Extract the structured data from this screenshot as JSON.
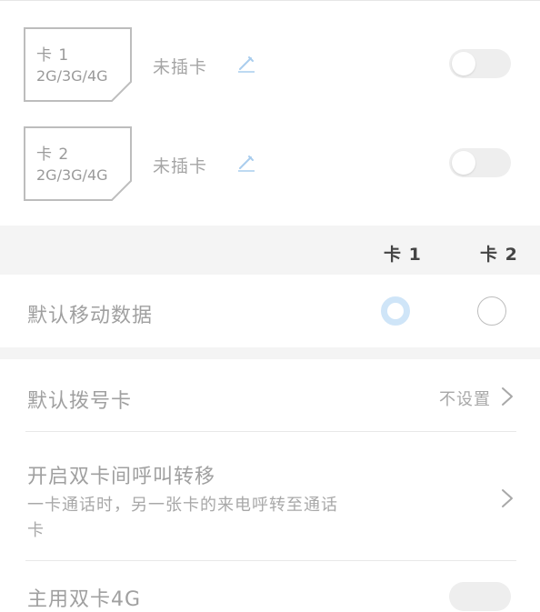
{
  "sims": [
    {
      "name": "卡 1",
      "network": "2G/3G/4G",
      "status": "未插卡",
      "edit_icon": "pencil-icon",
      "enabled": false
    },
    {
      "name": "卡 2",
      "network": "2G/3G/4G",
      "status": "未插卡",
      "edit_icon": "pencil-icon",
      "enabled": false
    }
  ],
  "card_header": {
    "card1": "卡 1",
    "card2": "卡 2"
  },
  "default_data": {
    "label": "默认移动数据",
    "selected": "卡 1"
  },
  "default_dial": {
    "label": "默认拨号卡",
    "value": "不设置"
  },
  "call_forward": {
    "label": "开启双卡间呼叫转移",
    "description": "一卡通话时，另一张卡的来电呼转至通话卡"
  },
  "partial_row": {
    "label": "主用双卡4G"
  },
  "colors": {
    "accent": "#cfe5f8",
    "edit_icon": "#a9cdee",
    "toggle_off": "#eeeeee",
    "band": "#f4f4f4"
  }
}
